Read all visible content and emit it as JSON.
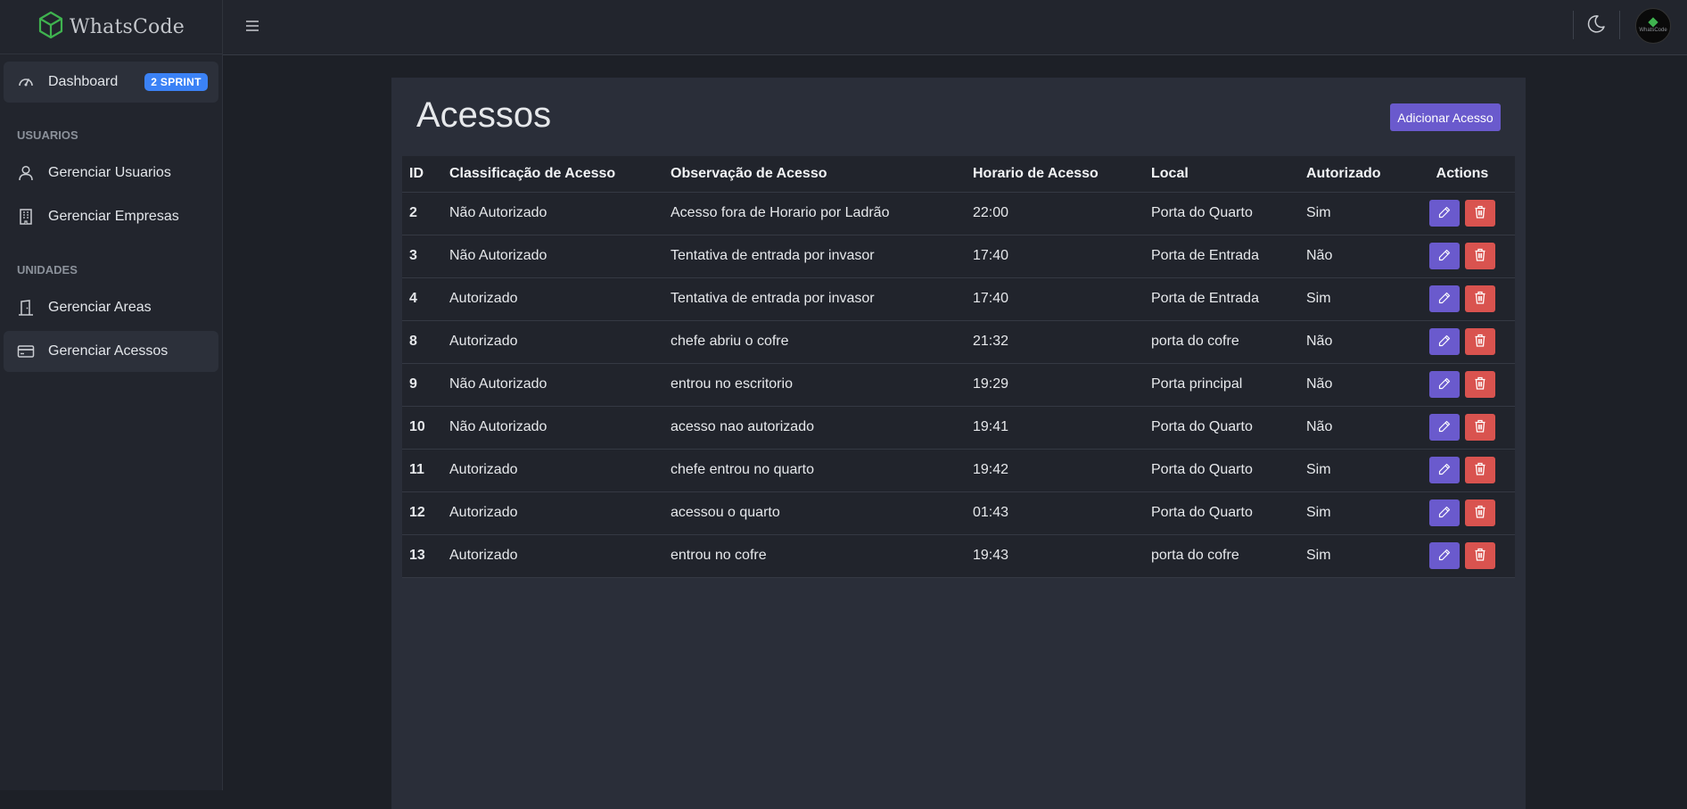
{
  "app": {
    "brand": "WhatsCode",
    "avatar_text": "WhatsCode",
    "colors": {
      "accent": "#6a5acd",
      "danger": "#d9534f",
      "badge": "#3b82f6",
      "logo": "#3fb34f"
    }
  },
  "sidebar": {
    "dashboard": {
      "label": "Dashboard",
      "icon": "gauge-icon",
      "badge": "2 SPRINT"
    },
    "section_usuarios": "USUARIOS",
    "section_unidades": "UNIDADES",
    "items": [
      {
        "label": "Gerenciar Usuarios",
        "icon": "user-icon"
      },
      {
        "label": "Gerenciar Empresas",
        "icon": "building-icon"
      },
      {
        "label": "Gerenciar Areas",
        "icon": "door-icon"
      },
      {
        "label": "Gerenciar Acessos",
        "icon": "card-icon",
        "active": true
      }
    ]
  },
  "topbar": {
    "menu_icon": "hamburger-icon",
    "theme_icon": "moon-icon"
  },
  "main": {
    "title": "Acessos",
    "add_button": "Adicionar Acesso",
    "columns": [
      "ID",
      "Classificação de Acesso",
      "Observação de Acesso",
      "Horario de Acesso",
      "Local",
      "Autorizado",
      "Actions"
    ],
    "rows": [
      {
        "id": "2",
        "classificacao": "Não Autorizado",
        "observacao": "Acesso fora de Horario por Ladrão",
        "horario": "22:00",
        "local": "Porta do Quarto",
        "autorizado": "Sim"
      },
      {
        "id": "3",
        "classificacao": "Não Autorizado",
        "observacao": "Tentativa de entrada por invasor",
        "horario": "17:40",
        "local": "Porta de Entrada",
        "autorizado": "Não"
      },
      {
        "id": "4",
        "classificacao": "Autorizado",
        "observacao": "Tentativa de entrada por invasor",
        "horario": "17:40",
        "local": "Porta de Entrada",
        "autorizado": "Sim"
      },
      {
        "id": "8",
        "classificacao": "Autorizado",
        "observacao": "chefe abriu o cofre",
        "horario": "21:32",
        "local": "porta do cofre",
        "autorizado": "Não"
      },
      {
        "id": "9",
        "classificacao": "Não Autorizado",
        "observacao": "entrou no escritorio",
        "horario": "19:29",
        "local": "Porta principal",
        "autorizado": "Não"
      },
      {
        "id": "10",
        "classificacao": "Não Autorizado",
        "observacao": "acesso nao autorizado",
        "horario": "19:41",
        "local": "Porta do Quarto",
        "autorizado": "Não"
      },
      {
        "id": "11",
        "classificacao": "Autorizado",
        "observacao": "chefe entrou no quarto",
        "horario": "19:42",
        "local": "Porta do Quarto",
        "autorizado": "Sim"
      },
      {
        "id": "12",
        "classificacao": "Autorizado",
        "observacao": "acessou o quarto",
        "horario": "01:43",
        "local": "Porta do Quarto",
        "autorizado": "Sim"
      },
      {
        "id": "13",
        "classificacao": "Autorizado",
        "observacao": "entrou no cofre",
        "horario": "19:43",
        "local": "porta do cofre",
        "autorizado": "Sim"
      }
    ]
  }
}
